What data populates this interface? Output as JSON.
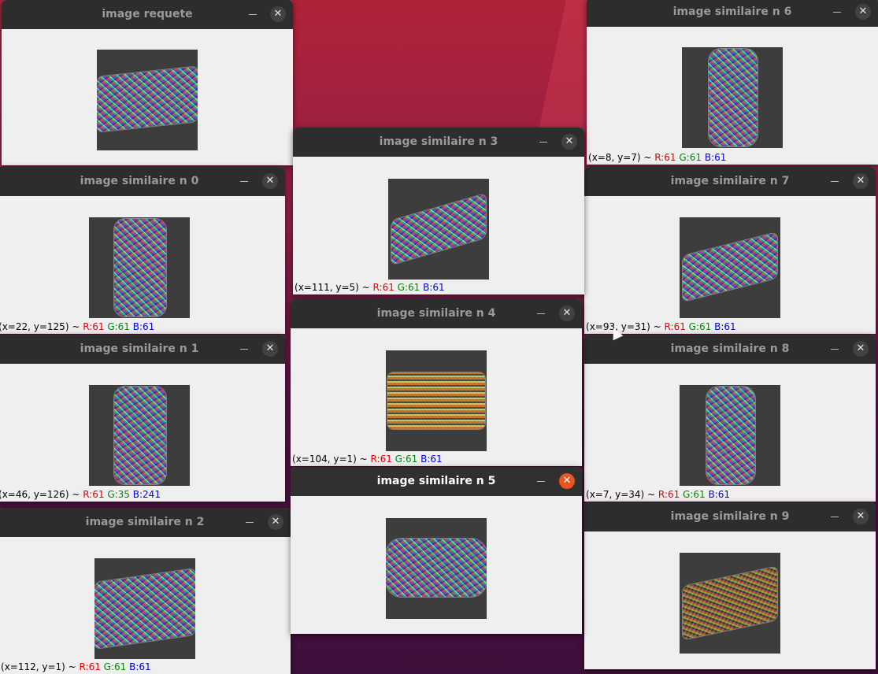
{
  "windows": {
    "query": {
      "title": "image requete"
    },
    "w0": {
      "title": "image similaire n 0",
      "coord": "x=22, y=125",
      "r": "61",
      "g": "61",
      "b": "61"
    },
    "w1": {
      "title": "image similaire n 1",
      "coord": "x=46, y=126",
      "r": "61",
      "g": "35",
      "b": "241"
    },
    "w2": {
      "title": "image similaire n 2",
      "coord": "x=112, y=1",
      "r": "61",
      "g": "61",
      "b": "61"
    },
    "w3": {
      "title": "image similaire n 3",
      "coord": "x=111, y=5",
      "r": "61",
      "g": "61",
      "b": "61"
    },
    "w4": {
      "title": "image similaire n 4",
      "coord": "x=104, y=1",
      "r": "61",
      "g": "61",
      "b": "61"
    },
    "w5": {
      "title": "image similaire n 5"
    },
    "w6": {
      "title": "image similaire n 6",
      "coord": "x=8, y=7",
      "r": "61",
      "g": "61",
      "b": "61"
    },
    "w7": {
      "title": "image similaire n 7",
      "coord": "x=93, y=31",
      "r": "61",
      "g": "61",
      "b": "61"
    },
    "w8": {
      "title": "image similaire n 8",
      "coord": "x=7, y=34",
      "r": "61",
      "g": "61",
      "b": "61"
    },
    "w9": {
      "title": "image similaire n 9"
    }
  },
  "labels": {
    "r": "R:",
    "g": "G:",
    "b": "B:",
    "sep": " ~ ",
    "open": "(",
    "close": ")"
  },
  "icons": {
    "minimize": "minimize-icon",
    "close": "close-icon"
  },
  "colors": {
    "close_active": "#e95420",
    "titlebar": "#2d2d2d"
  }
}
